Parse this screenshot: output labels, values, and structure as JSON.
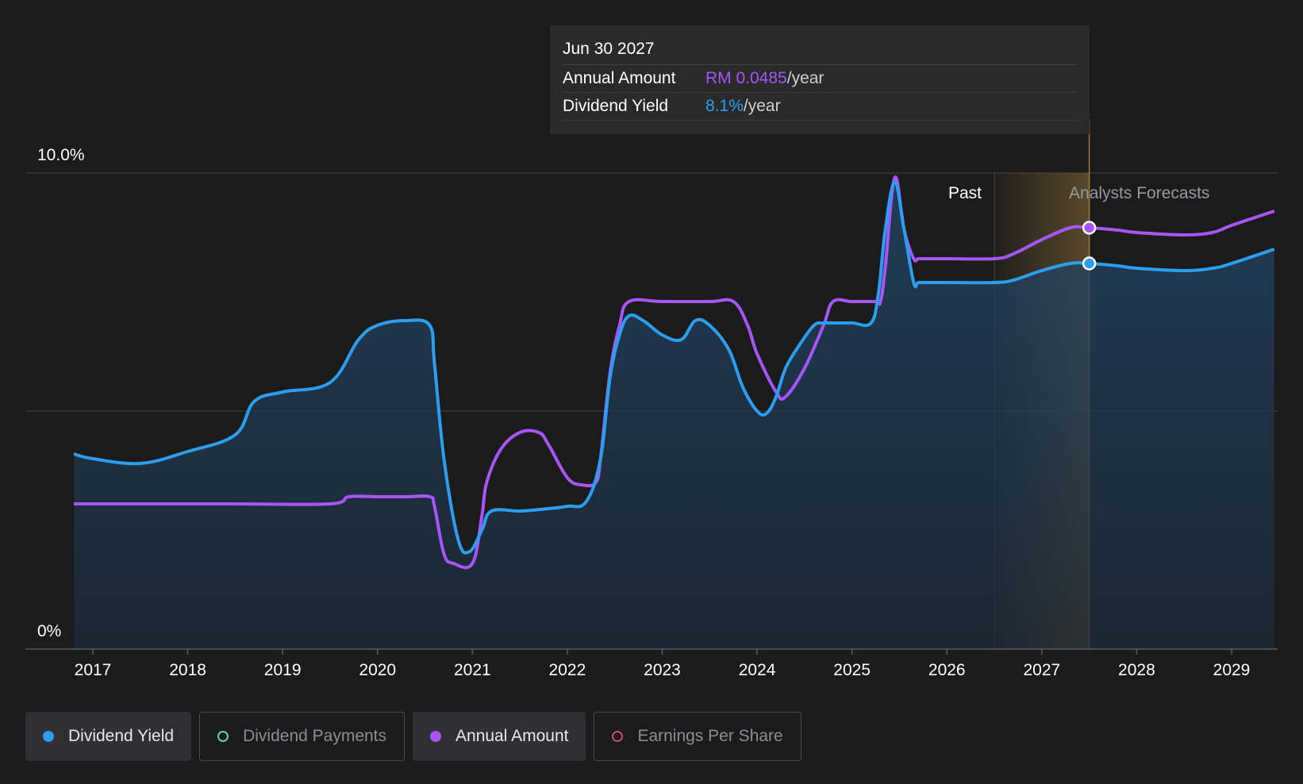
{
  "chart_data": {
    "type": "area",
    "y_tick_labels": [
      "10.0%",
      "0%"
    ],
    "ylim": [
      0,
      10
    ],
    "x_tick_labels": [
      "2017",
      "2018",
      "2019",
      "2020",
      "2021",
      "2022",
      "2023",
      "2024",
      "2025",
      "2026",
      "2027",
      "2028",
      "2029"
    ],
    "xlim": [
      2016.8,
      2029.45
    ],
    "past_label": "Past",
    "forecast_label": "Analysts Forecasts",
    "forecast_start": 2026.5,
    "highlight_x": 2027.5,
    "series": [
      {
        "name": "Dividend Yield",
        "color": "#2b9ef0",
        "x": [
          2016.8,
          2017.0,
          2017.5,
          2018.0,
          2018.5,
          2018.7,
          2019.0,
          2019.5,
          2019.8,
          2020.0,
          2020.3,
          2020.55,
          2020.6,
          2020.7,
          2020.85,
          2020.97,
          2021.1,
          2021.2,
          2021.5,
          2021.8,
          2022.0,
          2022.2,
          2022.35,
          2022.45,
          2022.55,
          2022.65,
          2022.8,
          2023.0,
          2023.2,
          2023.35,
          2023.5,
          2023.7,
          2023.85,
          2024.0,
          2024.1,
          2024.2,
          2024.3,
          2024.45,
          2024.6,
          2024.7,
          2024.8,
          2025.0,
          2025.2,
          2025.28,
          2025.35,
          2025.45,
          2025.55,
          2025.65,
          2025.7,
          2025.8,
          2026.0,
          2026.5,
          2026.7,
          2027.0,
          2027.3,
          2027.5,
          2027.8,
          2028.0,
          2028.5,
          2028.8,
          2029.0,
          2029.45
        ],
        "values": [
          4.1,
          4.0,
          3.9,
          4.15,
          4.5,
          5.2,
          5.4,
          5.6,
          6.5,
          6.8,
          6.9,
          6.8,
          6.0,
          4.0,
          2.3,
          2.05,
          2.5,
          2.9,
          2.9,
          2.95,
          3.0,
          3.1,
          4.0,
          5.7,
          6.6,
          7.0,
          6.9,
          6.6,
          6.5,
          6.9,
          6.8,
          6.3,
          5.5,
          5.0,
          4.95,
          5.3,
          5.9,
          6.4,
          6.8,
          6.85,
          6.85,
          6.85,
          6.85,
          7.5,
          8.8,
          9.8,
          8.8,
          7.7,
          7.7,
          7.7,
          7.7,
          7.7,
          7.75,
          7.95,
          8.1,
          8.1,
          8.05,
          8.0,
          7.95,
          8.0,
          8.1,
          8.4
        ]
      },
      {
        "name": "Annual Amount",
        "color": "#a855f7",
        "x": [
          2016.8,
          2017.5,
          2018.5,
          2019.5,
          2019.7,
          2020.0,
          2020.3,
          2020.55,
          2020.6,
          2020.7,
          2020.8,
          2021.0,
          2021.1,
          2021.15,
          2021.3,
          2021.5,
          2021.7,
          2021.8,
          2022.0,
          2022.15,
          2022.3,
          2022.35,
          2022.45,
          2022.55,
          2022.65,
          2023.0,
          2023.5,
          2023.75,
          2023.9,
          2024.0,
          2024.2,
          2024.3,
          2024.5,
          2024.7,
          2024.8,
          2025.0,
          2025.25,
          2025.3,
          2025.35,
          2025.45,
          2025.55,
          2025.65,
          2025.7,
          2025.8,
          2026.0,
          2026.5,
          2026.7,
          2027.0,
          2027.3,
          2027.5,
          2027.8,
          2028.0,
          2028.5,
          2028.8,
          2029.0,
          2029.45
        ],
        "values": [
          3.05,
          3.05,
          3.05,
          3.05,
          3.2,
          3.2,
          3.2,
          3.2,
          3.0,
          2.0,
          1.8,
          1.8,
          2.8,
          3.5,
          4.2,
          4.55,
          4.55,
          4.3,
          3.6,
          3.45,
          3.5,
          4.0,
          5.8,
          6.8,
          7.3,
          7.3,
          7.3,
          7.3,
          6.8,
          6.2,
          5.4,
          5.3,
          5.9,
          6.8,
          7.3,
          7.3,
          7.3,
          7.3,
          8.0,
          9.9,
          8.8,
          8.2,
          8.2,
          8.2,
          8.2,
          8.2,
          8.3,
          8.6,
          8.85,
          8.85,
          8.8,
          8.75,
          8.7,
          8.75,
          8.9,
          9.2
        ]
      }
    ]
  },
  "tooltip": {
    "date": "Jun 30 2027",
    "rows": [
      {
        "label": "Annual Amount",
        "value": "RM 0.0485",
        "unit": "/year"
      },
      {
        "label": "Dividend Yield",
        "value": "8.1%",
        "unit": "/year"
      }
    ]
  },
  "legend": [
    {
      "label": "Dividend Yield",
      "active": true,
      "color": "#2b9ef0"
    },
    {
      "label": "Dividend Payments",
      "active": false,
      "color": "#5ed1c2"
    },
    {
      "label": "Annual Amount",
      "active": true,
      "color": "#a855f7"
    },
    {
      "label": "Earnings Per Share",
      "active": false,
      "color": "#c8477d"
    }
  ]
}
